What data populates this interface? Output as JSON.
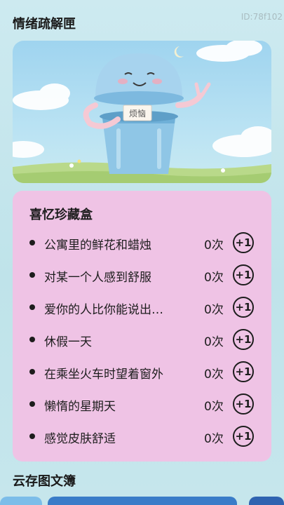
{
  "page": {
    "title": "情绪疏解匣",
    "id_label": "ID:78f102"
  },
  "banner": {
    "note_text": "烦恼"
  },
  "memory_box": {
    "title": "喜忆珍藏盒",
    "items": [
      {
        "text": "公寓里的鲜花和蜡烛",
        "count": "0次",
        "button": "+1"
      },
      {
        "text": "对某一个人感到舒服",
        "count": "0次",
        "button": "+1"
      },
      {
        "text": "爱你的人比你能说出…",
        "count": "0次",
        "button": "+1"
      },
      {
        "text": "休假一天",
        "count": "0次",
        "button": "+1"
      },
      {
        "text": "在乘坐火车时望着窗外",
        "count": "0次",
        "button": "+1"
      },
      {
        "text": "懒惰的星期天",
        "count": "0次",
        "button": "+1"
      },
      {
        "text": "感觉皮肤舒适",
        "count": "0次",
        "button": "+1"
      }
    ]
  },
  "cloud_album": {
    "title": "云存图文簿"
  },
  "colors": {
    "card_bg": "#efc3e5",
    "page_bg": "#c6e6ec"
  }
}
